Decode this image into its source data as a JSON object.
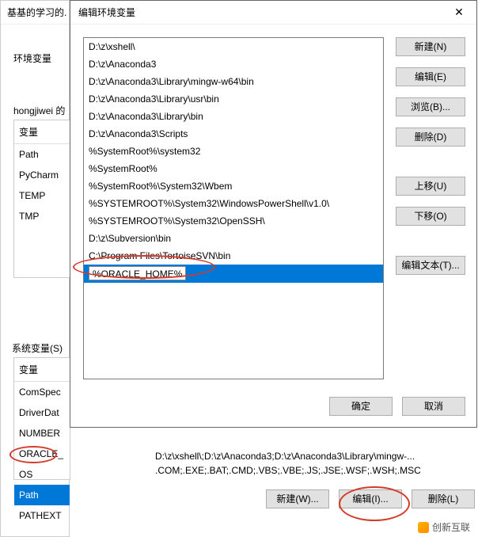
{
  "env_window": {
    "title_fragment": "基基的学习的.",
    "tab_label": "环境变量",
    "user_section_label": "hongjiwei 的",
    "user_table_header": "变量",
    "user_vars": [
      "Path",
      "PyCharm",
      "TEMP",
      "TMP"
    ],
    "sys_section_label": "系统变量(S)",
    "sys_table_header": "变量",
    "sys_vars": [
      "ComSpec",
      "DriverDat",
      "NUMBER",
      "ORACLE_",
      "OS",
      "Path",
      "PATHEXT"
    ],
    "sys_selected_index": 5,
    "sys_value_path": "D:\\z\\xshell\\;D:\\z\\Anaconda3;D:\\z\\Anaconda3\\Library\\mingw-...",
    "sys_value_pathext": ".COM;.EXE;.BAT;.CMD;.VBS;.VBE;.JS;.JSE;.WSF;.WSH;.MSC",
    "bottom_buttons": {
      "new": "新建(W)...",
      "edit": "编辑(I)...",
      "delete": "删除(L)"
    }
  },
  "edit_dialog": {
    "title": "编辑环境变量",
    "close_symbol": "✕",
    "items": [
      "D:\\z\\xshell\\",
      "D:\\z\\Anaconda3",
      "D:\\z\\Anaconda3\\Library\\mingw-w64\\bin",
      "D:\\z\\Anaconda3\\Library\\usr\\bin",
      "D:\\z\\Anaconda3\\Library\\bin",
      "D:\\z\\Anaconda3\\Scripts",
      "%SystemRoot%\\system32",
      "%SystemRoot%",
      "%SystemRoot%\\System32\\Wbem",
      "%SYSTEMROOT%\\System32\\WindowsPowerShell\\v1.0\\",
      "%SYSTEMROOT%\\System32\\OpenSSH\\",
      "D:\\z\\Subversion\\bin",
      "C:\\Program Files\\TortoiseSVN\\bin",
      "%ORACLE_HOME%"
    ],
    "selected_index": 13,
    "right_buttons": {
      "new": "新建(N)",
      "edit": "编辑(E)",
      "browse": "浏览(B)...",
      "delete": "删除(D)",
      "move_up": "上移(U)",
      "move_down": "下移(O)",
      "edit_text": "编辑文本(T)..."
    },
    "ok": "确定",
    "cancel": "取消"
  },
  "logo_text": "创新互联"
}
